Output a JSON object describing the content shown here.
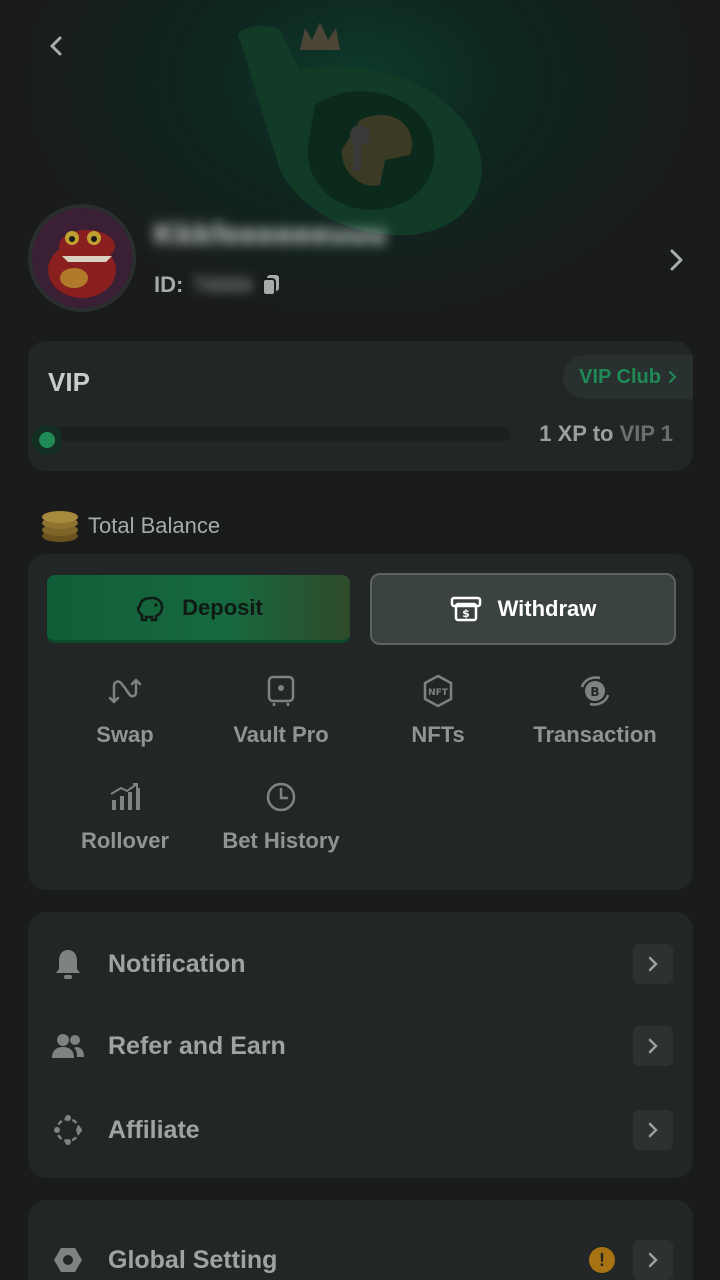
{
  "header": {
    "back_icon": "chevron-left-icon",
    "logo": "brand-crown-logo"
  },
  "profile": {
    "username": "Kkkfeeeeeeuuu",
    "id_label": "ID:",
    "id_value": "7iiiiiiiiii",
    "copy_icon": "copy-icon",
    "chevron_icon": "chevron-right-icon"
  },
  "vip": {
    "title": "VIP",
    "club_label": "VIP Club",
    "progress": 0.0,
    "xp_text": "1 XP to ",
    "next_level": "VIP 1"
  },
  "balance": {
    "label": "Total Balance",
    "icon": "coins-icon"
  },
  "wallet": {
    "deposit_label": "Deposit",
    "withdraw_label": "Withdraw",
    "actions": [
      {
        "label": "Swap",
        "icon": "swap-icon"
      },
      {
        "label": "Vault Pro",
        "icon": "vault-icon"
      },
      {
        "label": "NFTs",
        "icon": "nft-icon"
      },
      {
        "label": "Transaction",
        "icon": "transaction-icon"
      },
      {
        "label": "Rollover",
        "icon": "rollover-chart-icon"
      },
      {
        "label": "Bet History",
        "icon": "clock-icon"
      }
    ]
  },
  "menu": {
    "items": [
      {
        "label": "Notification",
        "icon": "bell-icon"
      },
      {
        "label": "Refer and Earn",
        "icon": "users-icon"
      },
      {
        "label": "Affiliate",
        "icon": "affiliate-icon"
      }
    ]
  },
  "settings": {
    "label": "Global Setting",
    "icon": "hexagon-gear-icon",
    "warning": "!"
  },
  "colors": {
    "background": "#1a1c1c",
    "card": "#222626",
    "accent_green": "#1f8a55",
    "warning": "#a87312"
  }
}
